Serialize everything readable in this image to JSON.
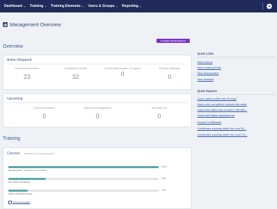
{
  "nav": {
    "items": [
      {
        "label": "Dashboard",
        "chev": "⌄"
      },
      {
        "label": "Training",
        "chev": "⌄"
      },
      {
        "label": "Training Elements",
        "chev": "⌄"
      },
      {
        "label": "Users & Groups",
        "chev": "⌄"
      },
      {
        "label": "Reporting",
        "chev": "⌄"
      }
    ],
    "settings_icon": "gear-icon"
  },
  "header": {
    "title": "Management Overview",
    "icon": "dashboard-icon",
    "configure_label": "Configure My Dashboard",
    "configure_color": "#7b2fc9"
  },
  "overview": {
    "title": "Overview",
    "action_required": {
      "title": "Action Required",
      "metrics": [
        {
          "label": "Unproved Assessments",
          "value": "23"
        },
        {
          "label": "Checklists for Review",
          "value": "32"
        },
        {
          "label": "Courses With Modules in Progress",
          "value": "0"
        },
        {
          "label": "Pending Certificates",
          "value": "0"
        }
      ]
    },
    "upcoming": {
      "title": "Upcoming",
      "metrics": [
        {
          "label": "Upcoming Deadlines",
          "value": "0"
        },
        {
          "label": "Upcoming Reassignments",
          "value": "0"
        },
        {
          "label": "Upcoming ILTs",
          "value": "0"
        }
      ]
    }
  },
  "training": {
    "title": "Training",
    "courses": {
      "title": "Courses",
      "subtitle": "Ranked by % of learners passed",
      "items": [
        {
          "name": "Managing Risk – Insurance and Contracts",
          "percent_label": "100%",
          "percent": 100
        },
        {
          "name": "CCT Skills to Roadmap",
          "percent_label": "25%",
          "percent": 25
        },
        {
          "name": "Safety Certificate Program",
          "percent_label": "13%",
          "percent": 13
        }
      ],
      "view_all": "View All Courses"
    }
  },
  "quick_links": {
    "title": "Quick Links",
    "items": [
      "New Course",
      "New Learning Path",
      "New Assessment",
      "New Material"
    ]
  },
  "quick_reports": {
    "title": "Quick Reports",
    "items": [
      "Users added within last 90 days",
      "Users who completed courses this week",
      "Users who failed any course in the last...",
      "Users with failed assessments",
      "Expired Certificates",
      "Certificates expiring within the next 30...",
      "Certificates expiring within the next 2 w..."
    ]
  },
  "colors": {
    "nav_bg": "#1f2a5a",
    "accent_bar": "#5aa7ad",
    "link": "#2b56a8"
  }
}
